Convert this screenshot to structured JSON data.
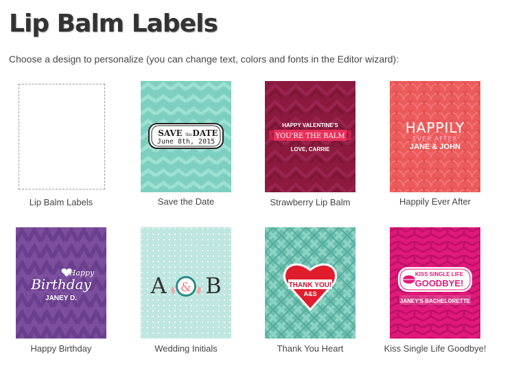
{
  "page": {
    "title": "Lip Balm Labels",
    "intro": "Choose a design to personalize (you can change text, colors and fonts in the Editor wizard):"
  },
  "designs": [
    {
      "caption": "Lip Balm Labels",
      "bg": "#ffffff"
    },
    {
      "caption": "Save the Date",
      "bg": "#7dd0bf",
      "text": {
        "l1": "SAVE",
        "the": "the",
        "l2": "DATE",
        "date": "June 8th, 2015"
      }
    },
    {
      "caption": "Strawberry Lip Balm",
      "bg": "#8b1a3e",
      "text": {
        "l1": "HAPPY VALENTINE'S",
        "l2": "YOU'RE THE BALM",
        "l3": "LOVE, CARRIE"
      }
    },
    {
      "caption": "Happily Ever After",
      "bg": "#ec5b5b",
      "text": {
        "l1": "HAPPILY",
        "l2": "EVER AFTER",
        "l3": "JANE & JOHN"
      }
    },
    {
      "caption": "Happy Birthday",
      "bg": "#7b4f9e",
      "text": {
        "l1": "Happy",
        "l2": "Birthday",
        "l3": "JANEY D."
      }
    },
    {
      "caption": "Wedding Initials",
      "bg": "#bfe6e0",
      "text": {
        "a": "A",
        "amp": "&",
        "b": "B"
      }
    },
    {
      "caption": "Thank You Heart",
      "bg": "#6bbfae",
      "text": {
        "l1": "THANK YOU!",
        "l2": "A&S"
      }
    },
    {
      "caption": "Kiss Single Life Goodbye!",
      "bg": "#e0197a",
      "text": {
        "l1": "KISS SINGLE LIFE",
        "l2": "GOODBYE!",
        "l3": "JANEY'S BACHELORETTE"
      }
    }
  ]
}
